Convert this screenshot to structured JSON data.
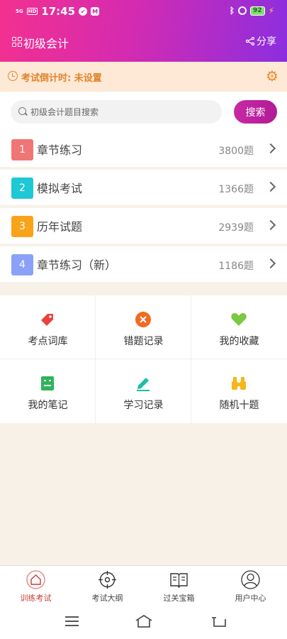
{
  "status_bar": {
    "network": "5G",
    "hd": "HD",
    "time": "17:45",
    "battery": "92"
  },
  "header": {
    "title": "初级会计",
    "share_label": "分享"
  },
  "countdown": {
    "text": "考试倒计时: 未设置"
  },
  "search": {
    "placeholder": "初级会计题目搜索",
    "button_label": "搜索"
  },
  "practice_list": [
    {
      "num": "1",
      "title": "章节练习",
      "count": "3800题",
      "color": "#f07575"
    },
    {
      "num": "2",
      "title": "模拟考试",
      "count": "1366题",
      "color": "#1ec8d4"
    },
    {
      "num": "3",
      "title": "历年试题",
      "count": "2939题",
      "color": "#f9a31a"
    },
    {
      "num": "4",
      "title": "章节练习（新）",
      "count": "1186题",
      "color": "#8aa1f7"
    }
  ],
  "tools": [
    {
      "label": "考点词库",
      "icon": "tag-icon",
      "color": "#e8433b"
    },
    {
      "label": "错题记录",
      "icon": "x-circle-icon",
      "color": "#f26b22"
    },
    {
      "label": "我的收藏",
      "icon": "heart-icon",
      "color": "#7bc843"
    },
    {
      "label": "我的笔记",
      "icon": "notebook-icon",
      "color": "#2fb45c"
    },
    {
      "label": "学习记录",
      "icon": "pencil-icon",
      "color": "#1bbfa8"
    },
    {
      "label": "随机十题",
      "icon": "binoculars-icon",
      "color": "#f7b51a"
    }
  ],
  "tabs": [
    {
      "label": "训练考试",
      "icon": "home-icon",
      "active": true
    },
    {
      "label": "考试大纲",
      "icon": "target-icon",
      "active": false
    },
    {
      "label": "过关宝箱",
      "icon": "book-icon",
      "active": false
    },
    {
      "label": "用户中心",
      "icon": "user-icon",
      "active": false
    }
  ],
  "colors": {
    "header_gradient_start": "#f3308f",
    "header_gradient_end": "#8b2ee0",
    "countdown_bg": "#fde9d6",
    "countdown_text": "#e0842b",
    "active_tab": "#c53d39"
  }
}
